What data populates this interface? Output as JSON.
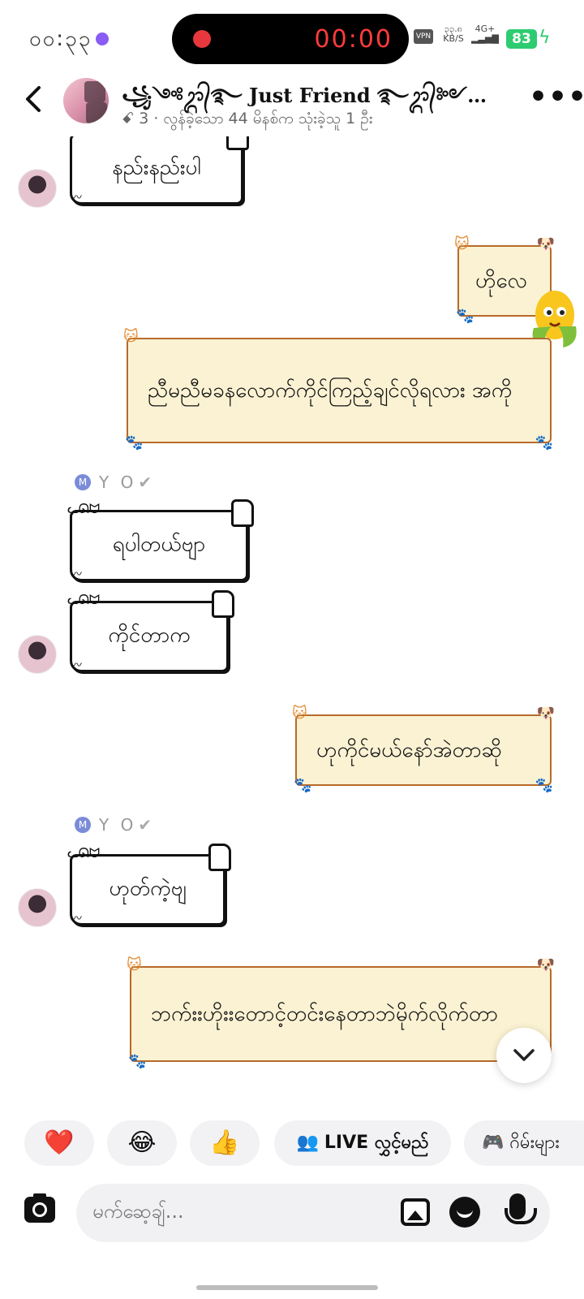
{
  "status_bar": {
    "time": "၀၀:၃၃",
    "recording_time": "00:00",
    "vpn": "VPN",
    "speed_value": "၃၃.၈",
    "speed_unit": "KB/S",
    "network": "4G+",
    "battery": "83"
  },
  "header": {
    "group_name": "꧁༺ᬊ᭄࿐ Just Friend ࿐ᬊ᭄༻꧂...",
    "subtitle": "ꗃ 3 · လွန်ခဲ့သော 44 မိနစ်က သုံးခဲ့သူ 1 ဦး"
  },
  "messages": [
    {
      "side": "left",
      "text": "နည်းနည်းပါ"
    },
    {
      "side": "right",
      "text": "ဟိုလေ"
    },
    {
      "side": "right",
      "text": "ညီမညီမခနလောက်ကိုင်ကြည့်ချင်လိုရလား အကို"
    },
    {
      "side": "left",
      "sender": "Y O",
      "sender_initial": "M",
      "text": "ရပါတယ်ဗျာ"
    },
    {
      "side": "left",
      "text": "ကိုင်တာက"
    },
    {
      "side": "right",
      "text": "ဟုကိုင်မယ်နော်အဲတာဆို"
    },
    {
      "side": "left",
      "sender": "Y O",
      "sender_initial": "M",
      "text": "ဟုတ်ကဲ့ဗျ"
    },
    {
      "side": "right",
      "text": "ဘက်းးဟိုးးတောင့်တင်းနေတာဘဲမိုက်လိုက်တာ"
    }
  ],
  "quick_actions": [
    {
      "label": "",
      "icon": "heart-icon",
      "glyph": "❤️"
    },
    {
      "label": "",
      "icon": "laugh-icon",
      "glyph": "😂"
    },
    {
      "label": "",
      "icon": "thumbs-up-icon",
      "glyph": "👍"
    },
    {
      "label": "LIVE လွှင့်မည်",
      "icon": "people-icon",
      "glyph": "👥"
    },
    {
      "label": "ဂိမ်းများ",
      "icon": "gamepad-icon",
      "glyph": "🎮"
    }
  ],
  "composer": {
    "placeholder": "မက်ဆေ့ချ်..."
  },
  "colors": {
    "right_bubble_fill": "#fbf2d3",
    "right_bubble_border": "#b76a2b",
    "battery": "#2ecc71",
    "recording": "#ff3b3b"
  }
}
